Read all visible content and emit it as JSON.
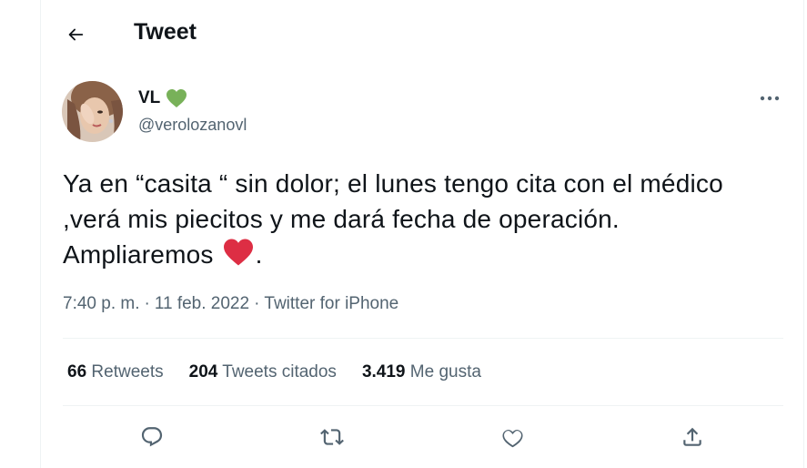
{
  "header": {
    "title": "Tweet",
    "back_icon": "arrow-left-icon"
  },
  "author": {
    "name": "VL",
    "name_emoji": "💚",
    "handle": "@verolozanovl"
  },
  "tweet": {
    "text": "Ya en “casita “ sin dolor; el lunes tengo cita con el médico ,verá mis piecitos y me dará fecha de operación. Ampliaremos ",
    "text_end": ".",
    "heart_emoji": "❤️",
    "time": "7:40 p. m.",
    "date": "11 feb. 2022",
    "source": "Twitter for iPhone",
    "sep": "·"
  },
  "stats": {
    "retweets": {
      "count": "66",
      "label": "Retweets"
    },
    "quotes": {
      "count": "204",
      "label": "Tweets citados"
    },
    "likes": {
      "count": "3.419",
      "label": "Me gusta"
    }
  },
  "colors": {
    "text": "#0f1419",
    "secondary": "#536471",
    "border": "#eff3f4",
    "heart": "#e0245e",
    "green_heart": "#78b159"
  },
  "actions": [
    "reply-icon",
    "retweet-icon",
    "like-icon",
    "share-icon"
  ]
}
